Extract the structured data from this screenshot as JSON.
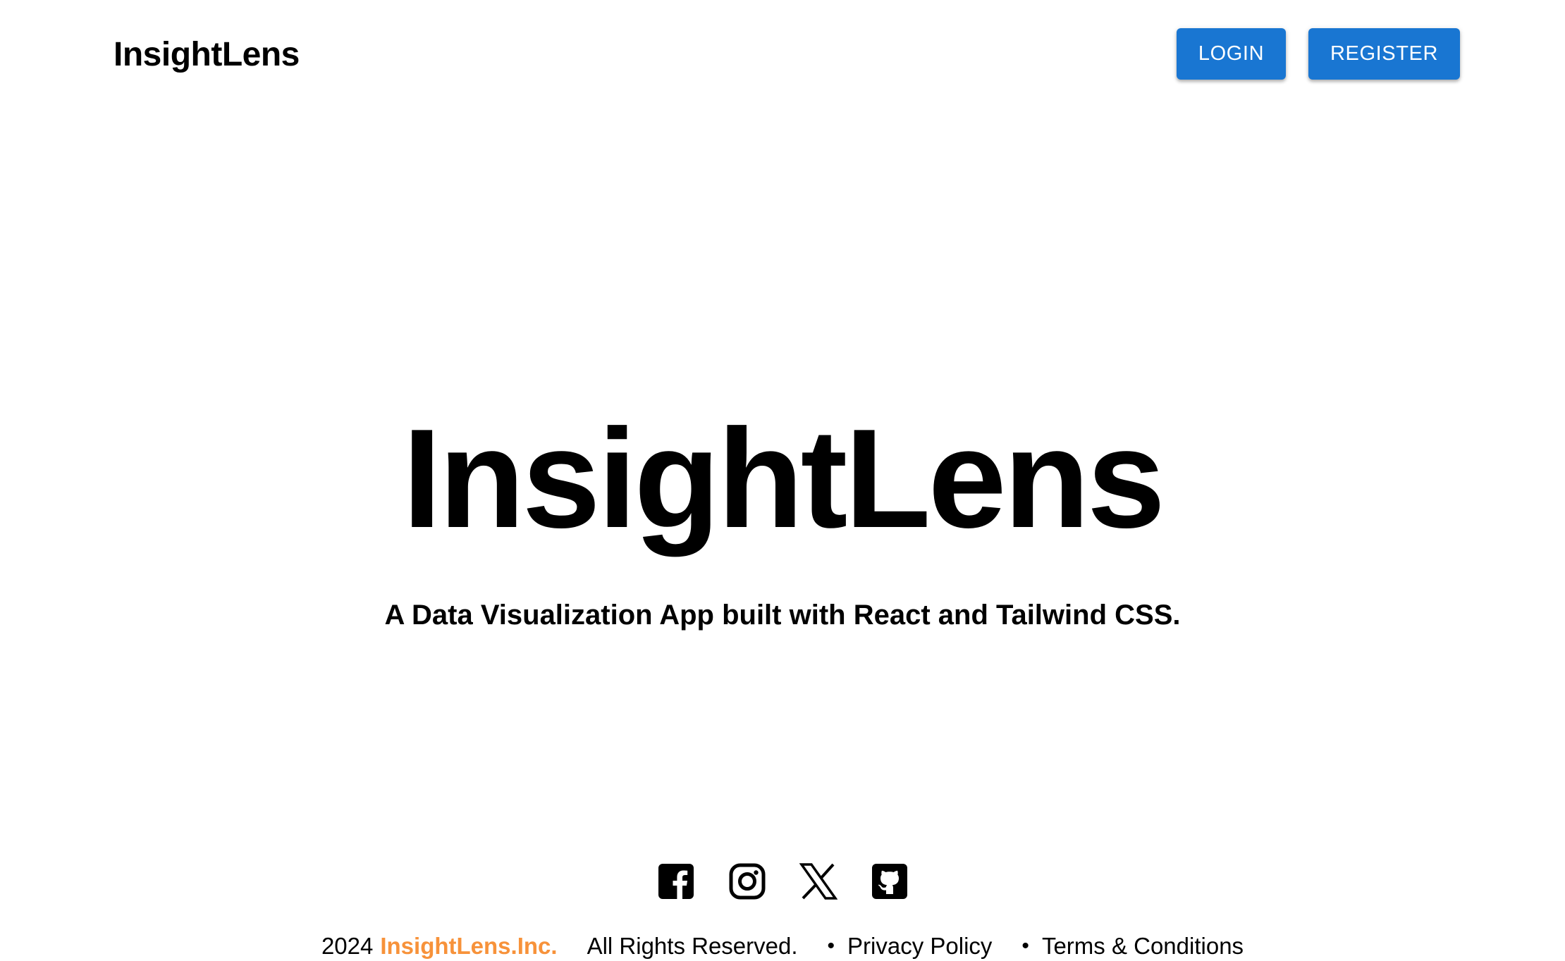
{
  "header": {
    "brand": "InsightLens",
    "login_label": "LOGIN",
    "register_label": "REGISTER",
    "button_color": "#1976d2"
  },
  "hero": {
    "title": "InsightLens",
    "subtitle": "A Data Visualization App built with React and Tailwind CSS."
  },
  "social": {
    "icons": [
      "facebook-icon",
      "instagram-icon",
      "x-icon",
      "github-icon"
    ]
  },
  "footer": {
    "year": "2024",
    "company": "InsightLens.Inc.",
    "company_color": "#f7923a",
    "rights": "All Rights Reserved.",
    "separator": "•",
    "privacy": "Privacy Policy",
    "terms": "Terms & Conditions"
  }
}
